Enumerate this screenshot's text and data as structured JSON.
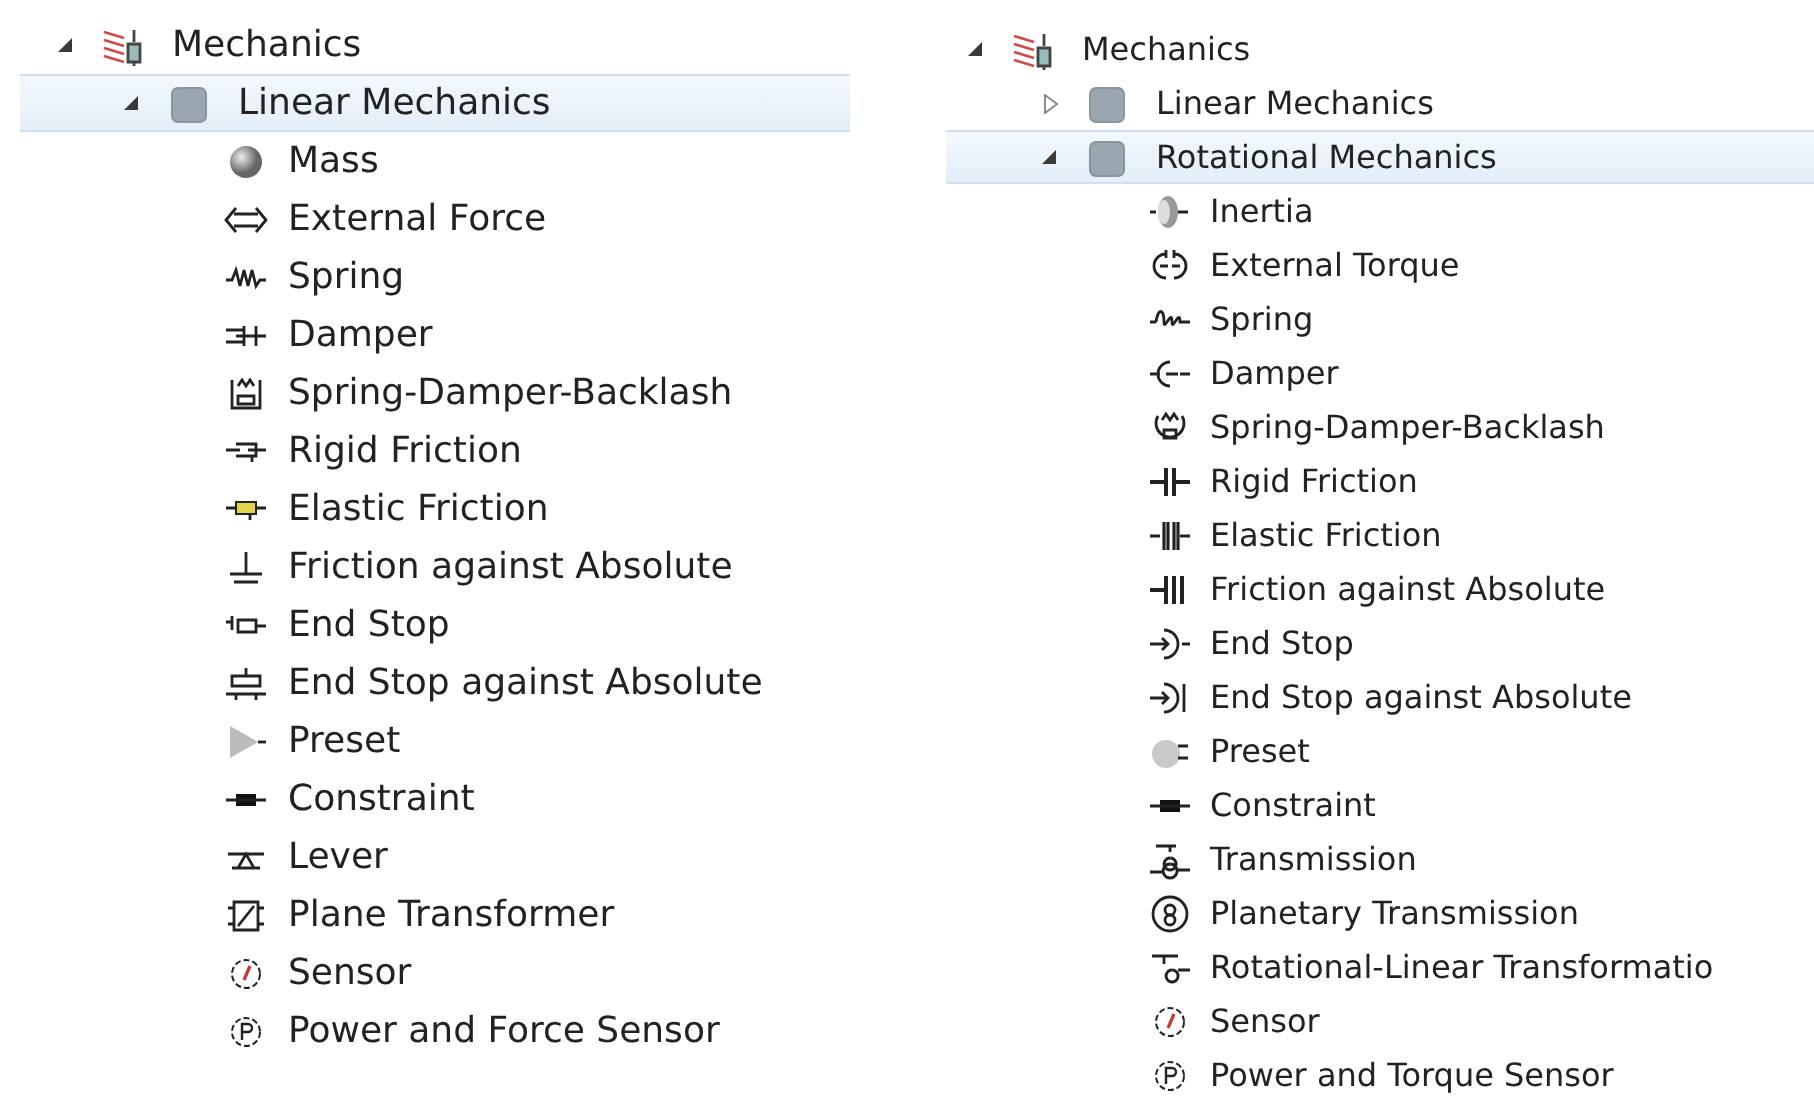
{
  "panels": [
    {
      "tree": [
        {
          "label": "Mechanics",
          "kind": "mechanics",
          "expanded": true,
          "selected": false,
          "children": [
            {
              "label": "Linear Mechanics",
              "kind": "library",
              "expanded": true,
              "selected": true,
              "children": [
                {
                  "label": "Mass",
                  "kind": "mass",
                  "selected": false
                },
                {
                  "label": "External Force",
                  "kind": "force",
                  "selected": false
                },
                {
                  "label": "Spring",
                  "kind": "spring",
                  "selected": false
                },
                {
                  "label": "Damper",
                  "kind": "damper",
                  "selected": false
                },
                {
                  "label": "Spring-Damper-Backlash",
                  "kind": "backlash",
                  "selected": false
                },
                {
                  "label": "Rigid Friction",
                  "kind": "rigid-friction",
                  "selected": false
                },
                {
                  "label": "Elastic Friction",
                  "kind": "elastic-friction",
                  "selected": false
                },
                {
                  "label": "Friction against Absolute",
                  "kind": "friction-abs",
                  "selected": false
                },
                {
                  "label": "End Stop",
                  "kind": "end-stop",
                  "selected": false
                },
                {
                  "label": "End Stop against Absolute",
                  "kind": "end-stop-abs",
                  "selected": false
                },
                {
                  "label": "Preset",
                  "kind": "preset",
                  "selected": false
                },
                {
                  "label": "Constraint",
                  "kind": "constraint",
                  "selected": false
                },
                {
                  "label": "Lever",
                  "kind": "lever",
                  "selected": false
                },
                {
                  "label": "Plane Transformer",
                  "kind": "plane-transformer",
                  "selected": false
                },
                {
                  "label": "Sensor",
                  "kind": "sensor",
                  "selected": false
                },
                {
                  "label": "Power and Force Sensor",
                  "kind": "power-sensor",
                  "selected": false
                }
              ]
            }
          ]
        }
      ]
    },
    {
      "tree": [
        {
          "label": "Mechanics",
          "kind": "mechanics",
          "expanded": true,
          "selected": false,
          "children": [
            {
              "label": "Linear Mechanics",
              "kind": "library",
              "expanded": false,
              "selected": false
            },
            {
              "label": "Rotational Mechanics",
              "kind": "library",
              "expanded": true,
              "selected": true,
              "children": [
                {
                  "label": "Inertia",
                  "kind": "inertia",
                  "selected": false
                },
                {
                  "label": "External Torque",
                  "kind": "torque",
                  "selected": false
                },
                {
                  "label": "Spring",
                  "kind": "rot-spring",
                  "selected": false
                },
                {
                  "label": "Damper",
                  "kind": "rot-damper",
                  "selected": false
                },
                {
                  "label": "Spring-Damper-Backlash",
                  "kind": "rot-backlash",
                  "selected": false
                },
                {
                  "label": "Rigid Friction",
                  "kind": "rot-rigid-friction",
                  "selected": false
                },
                {
                  "label": "Elastic Friction",
                  "kind": "rot-elastic-friction",
                  "selected": false
                },
                {
                  "label": "Friction against Absolute",
                  "kind": "rot-friction-abs",
                  "selected": false
                },
                {
                  "label": "End Stop",
                  "kind": "rot-end-stop",
                  "selected": false
                },
                {
                  "label": "End Stop against Absolute",
                  "kind": "rot-end-stop-abs",
                  "selected": false
                },
                {
                  "label": "Preset",
                  "kind": "rot-preset",
                  "selected": false
                },
                {
                  "label": "Constraint",
                  "kind": "constraint",
                  "selected": false
                },
                {
                  "label": "Transmission",
                  "kind": "transmission",
                  "selected": false
                },
                {
                  "label": "Planetary Transmission",
                  "kind": "planetary",
                  "selected": false
                },
                {
                  "label": "Rotational-Linear Transformatio",
                  "kind": "rot-lin",
                  "selected": false
                },
                {
                  "label": "Sensor",
                  "kind": "sensor",
                  "selected": false
                },
                {
                  "label": "Power and Torque Sensor",
                  "kind": "power-sensor",
                  "selected": false
                }
              ]
            }
          ]
        }
      ]
    }
  ]
}
